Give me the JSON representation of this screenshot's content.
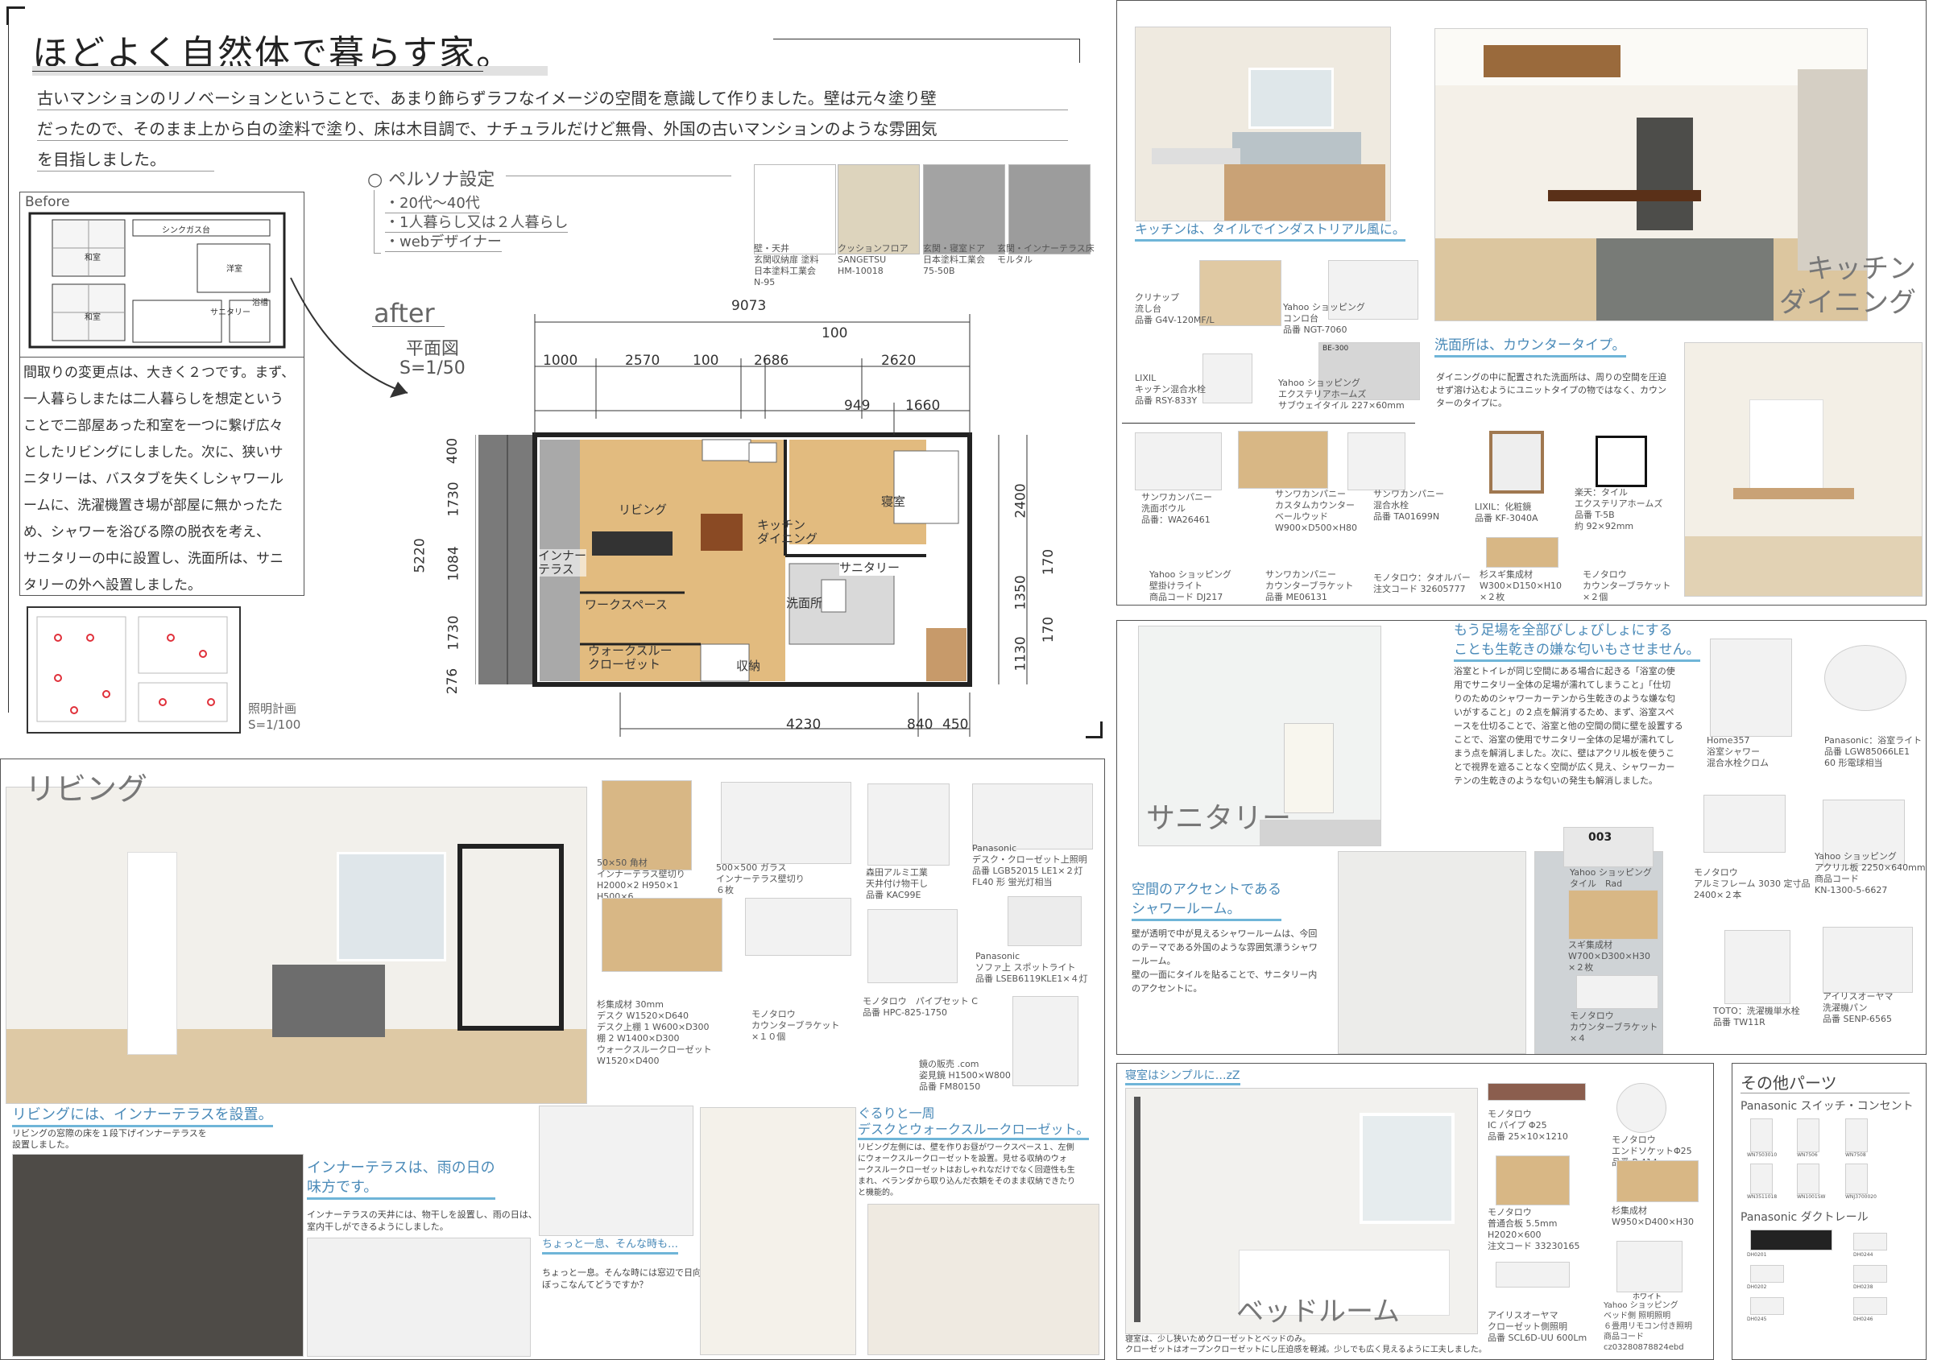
{
  "header": {
    "title": "ほどよく自然体で暮らす家。",
    "intro": "古いマンションのリノベーションということで、あまり飾らずラフなイメージの空間を意識して作りました。壁は元々塗り壁\nだったので、そのまま上から白の塗料で塗り、床は木目調で、ナチュラルだけど無骨、外国の古いマンションのような雰囲気\nを目指しました。"
  },
  "before": {
    "label": "Before",
    "rooms": [
      "シンク",
      "ガス台",
      "和室",
      "洋室",
      "和室",
      "サニタリー",
      "浴槽"
    ],
    "description": "間取りの変更点は、大きく２つです。まず、\n一人暮らしまたは二人暮らしを想定という\nことで二部屋あった和室を一つに繋げ広々\nとしたリビングにしました。次に、狭いサ\nニタリーは、バスタブを失くしシャワール\nームに、洗濯機置き場が部屋に無かったた\nめ、シャワーを浴びる際の脱衣を考え、\nサニタリーの中に設置し、洗面所は、サニ\nタリーの外へ設置しました。",
    "lighting": "照明計画\nS=1/100"
  },
  "persona": {
    "title": "○ ペルソナ設定",
    "items": [
      "・20代〜40代",
      "・1人暮らし又は２人暮らし",
      "・webデザイナー"
    ]
  },
  "materials": [
    {
      "label": "壁・天井\n玄関収納扉 塗料\n日本塗料工業会\nN-95",
      "color": "#ffffff"
    },
    {
      "label": "クッションフロア\nSANGETSU\nHM-10018",
      "color": "#ddd4bd"
    },
    {
      "label": "玄関・寝室ドア\n日本塗料工業会\n75-50B",
      "color": "#a3a3a3"
    },
    {
      "label": "玄関・インナーテラス床\nモルタル",
      "color": "#9c9c9c"
    }
  ],
  "plan": {
    "after": "after",
    "scale_title": "平面図\nS=1/50",
    "dims_top": [
      "9073",
      "100",
      "1000",
      "2570",
      "100",
      "2686",
      "2620",
      "949",
      "1660"
    ],
    "dims_left": [
      "5220",
      "400",
      "1730",
      "1084",
      "1730",
      "276"
    ],
    "dims_right": [
      "2400",
      "170",
      "1350",
      "170",
      "1130"
    ],
    "dims_bottom": [
      "4230",
      "840",
      "450"
    ],
    "rooms": [
      "リビング",
      "キッチン\nダイニング",
      "寝室",
      "インナー\nテラス",
      "ワークスペース",
      "サニタリー",
      "洗面所",
      "ウォークスルー\nクローゼット",
      "収納"
    ]
  },
  "kitchen": {
    "section": "キッチン\nダイニング",
    "headline": "キッチンは、タイルでインダストリアル風に。",
    "items": [
      "クリナップ\n流し台\n品番 G4V-120MF/L",
      "Yahoo ショッピング\nコンロ台\n品番 NGT-7060",
      "LIXIL\nキッチン混合水栓\n品番 RSY-833Y",
      "Yahoo ショッピング\nエクステリアホームズ\nサブウェイタイル 227×60mm",
      "サンワカンパニー\n洗面ボウル\n品番：WA26461",
      "サンワカンパニー\nカスタムカウンター\nベールウッド\nW900×D500×H80",
      "サンワカンパニー\n混合水栓\n品番 TA01699N",
      "LIXIL：化粧鏡\n品番 KF-3040A",
      "楽天：タイル\nエクステリアホームズ\n品番 T-5B\n約 92×92mm",
      "Yahoo ショッピング\n壁掛けライト\n商品コード DJ217",
      "サンワカンパニー\nカウンターブラケット\n品番 ME06131",
      "モノタロウ：タオルバー\n注文コード 32605777",
      "杉スギ集成材\nW300×D150×H10\n×２枚",
      "モノタロウ\nカウンターブラケット\n×２個"
    ],
    "tile_code": "BE-300",
    "tile_brand": "SUBWAY"
  },
  "washroom": {
    "headline": "洗面所は、カウンタータイプ。",
    "body": "ダイニングの中に配置された洗面所は、周りの空間を圧迫\nせず溶け込むようにユニットタイプの物ではなく、カウン\nターのタイプに。"
  },
  "sanitary": {
    "section": "サニタリー",
    "headline": "もう足場を全部びしょびしょにする\nことも生乾きの嫌な匂いもさせません。",
    "body": "浴室とトイレが同じ空間にある場合に起きる「浴室の使\n用でサニタリー全体の足場が濡れてしまうこと」「仕切\nりのためのシャワーカーテンから生乾きのような嫌な匂\nいがすること」の２点を解消するため、まず、浴室スペ\nースを仕切ることで、浴室と他の空間の間に壁を設置する\nことで、浴室の使用でサニタリー全体の足場が濡れてし\nまう点を解消しました。次に、壁はアクリル板を使うこ\nとで視界を遮ることなく空間が広く見え、シャワーカー\nテンの生乾きのような匂いの発生も解消しました。",
    "headline2": "空間のアクセントである\nシャワールーム。",
    "body2": "壁が透明で中が見えるシャワールームは、今回\nのテーマである外国のような雰囲気漂うシャワ\nールーム。\n壁の一面にタイルを貼ることで、サニタリー内\nのアクセントに。",
    "items": [
      "Home357\n浴室シャワー\n混合水栓クロム",
      "Panasonic：浴室ライト\n品番 LGW85066LE1\n60 形電球相当",
      "Yahoo ショッピング\nタイル　Rad",
      "モノタロウ\nアルミフレーム 3030 定寸品\n2400×２本",
      "Yahoo ショッピング\nアクリル板 2250×640mm\n商品コード\nKN-1300-5-6627",
      "スギ集成材\nW700×D300×H30\n×２枚",
      "モノタロウ\nカウンターブラケット\n×４",
      "TOTO：洗濯機単水栓\n品番 TW11R",
      "アイリスオーヤマ\n洗濯機パン\n品番 SENP-6565"
    ],
    "tile_code": "003"
  },
  "living": {
    "section": "リビング",
    "headline1": "リビングには、インナーテラスを設置。",
    "body1": "リビングの窓際の床を１段下げインナーテラスを\n設置しました。",
    "headline2": "インナーテラスは、雨の日の\n味方です。",
    "body2": "インナーテラスの天井には、物干しを設置し、雨の日は、\n室内干しができるようにしました。",
    "headline3": "ちょっと一息、そんな時も…",
    "body3": "ちょっと一息。そんな時には窓辺で日向\nぼっこなんてどうですか？",
    "headline4": "ぐるりと一周\nデスクとウォークスルークローゼット。",
    "body4": "リビング左側には、壁を作りお昼がワークスペース１、左側\nにウォークスルークローゼットを設置。見せる収納のウォ\nークスルークローゼットはおしゃれなだけでなく回遊性も生\nまれ、ベランダから取り込んだ衣類をそのまま収納できたり\nと機能的。",
    "items": [
      "50×50 角材\nインナーテラス壁切り\nH2000×2 H950×1\nH500×6",
      "500×500 ガラス\nインナーテラス壁切り\n６枚",
      "森田アルミ工業\n天井付け物干し\n品番 KAC99E",
      "Panasonic\nデスク・クローゼット上照明\n品番 LGB52015 LE1×２灯\nFL40 形 蛍光灯相当",
      "Panasonic\nソファ上 スポットライト\n品番 LSEB6119KLE1×４灯",
      "杉集成材 30mm\nデスク W1520×D640\nデスク上棚 1 W600×D300\n棚 2 W1400×D300\nウォークスルークローゼット\nW1520×D400",
      "モノタロウ\nカウンターブラケット\n×１０個",
      "モノタロウ　パイプセット C\n品番 HPC-825-1750",
      "鏡の販売 .com\n姿見鏡 H1500×W800\n品番 FM80150"
    ]
  },
  "bedroom": {
    "section": "ベッドルーム",
    "headline": "寝室はシンプルに…zZ",
    "body": "寝室は、少し狭いためクローゼットとベッドのみ。\nクローゼットはオープンクローゼットにし圧迫感を軽減。少しでも広く見えるように工夫しました。",
    "items": [
      "モノタロウ\nIC パイプ Φ25\n品番 25×10×1210",
      "モノタロウ\nエンドソケットΦ25\n品番 P-414",
      "モノタロウ\n普通合板 5.5mm\nH2020×600\n注文コード 33230165",
      "杉集成材\nW950×D400×H30",
      "アイリスオーヤマ\nクローゼット側照明\n品番 SCL6D-UU 600Lm",
      "Yahoo ショッピング\nベッド側 照明照明\n６畳用リモコン付き照明\n商品コード cz03280878824ebd"
    ],
    "badge": "ホワイト"
  },
  "other": {
    "title": "その他パーツ",
    "sub1": "Panasonic スイッチ・コンセント",
    "parts1": [
      "WN7503010",
      "WN7506",
      "WN7508",
      "WN3511018",
      "WN1001SW",
      "WNJ3700020"
    ],
    "sub2": "Panasonic ダクトレール",
    "parts2": [
      "DH0201",
      "DH0244",
      "DH0202",
      "DH0238",
      "DH0245",
      "DH0246"
    ]
  }
}
